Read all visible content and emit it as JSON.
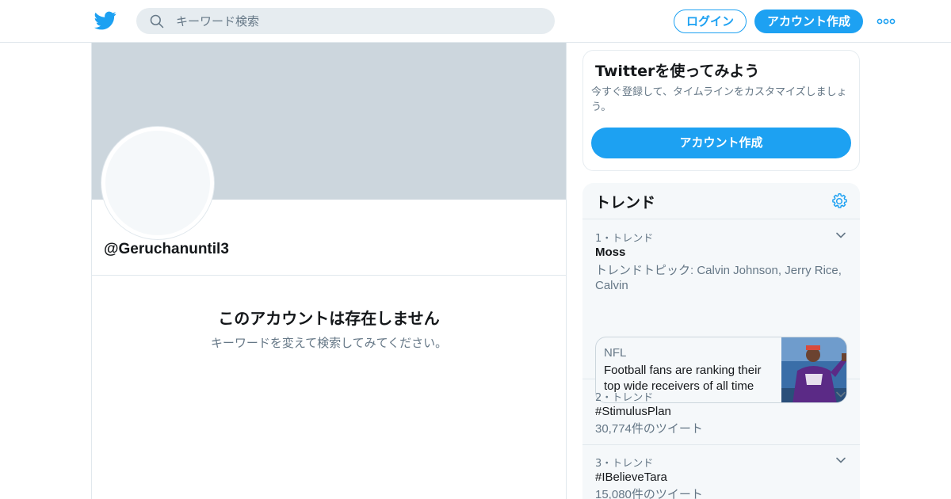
{
  "brand": {
    "accent": "#1da1f2",
    "logo_icon": "twitter-bird-icon"
  },
  "search": {
    "placeholder": "キーワード検索",
    "icon": "search-icon"
  },
  "header": {
    "login_label": "ログイン",
    "signup_label": "アカウント作成",
    "more_icon": "more-icon"
  },
  "profile": {
    "handle": "@Geruchanuntil3",
    "empty_title": "このアカウントは存在しません",
    "empty_subtitle": "キーワードを変えて検索してみてください。"
  },
  "signup_card": {
    "title": "Twitterを使ってみよう",
    "description": "今すぐ登録して、タイムラインをカスタマイズしましょう。",
    "button_label": "アカウント作成"
  },
  "trends": {
    "title": "トレンド",
    "settings_icon": "gear-icon",
    "items": [
      {
        "meta": "1・トレンド",
        "name": "Moss",
        "desc": "トレンドトピック: Calvin Johnson, Jerry Rice, Calvin",
        "news": {
          "source": "NFL",
          "headline": "Football fans are ranking their top wide receivers of all time"
        }
      },
      {
        "meta": "2・トレンド",
        "name": "#StimulusPlan",
        "desc": "30,774件のツイート"
      },
      {
        "meta": "3・トレンド",
        "name": "#IBelieveTara",
        "desc": "15,080件のツイート"
      }
    ]
  }
}
